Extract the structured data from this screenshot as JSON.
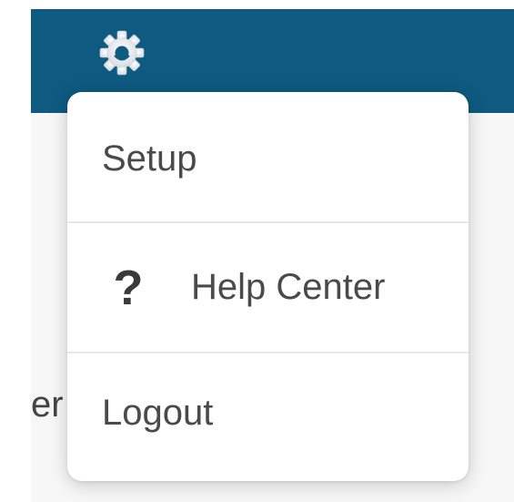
{
  "header": {
    "settings_icon": "gear-icon",
    "accent_color": "#0e5a80"
  },
  "background": {
    "partial_text": "er"
  },
  "menu": {
    "items": [
      {
        "label": "Setup"
      },
      {
        "label": "Help Center",
        "icon": "question-mark-icon",
        "icon_glyph": "?"
      },
      {
        "label": "Logout"
      }
    ]
  }
}
